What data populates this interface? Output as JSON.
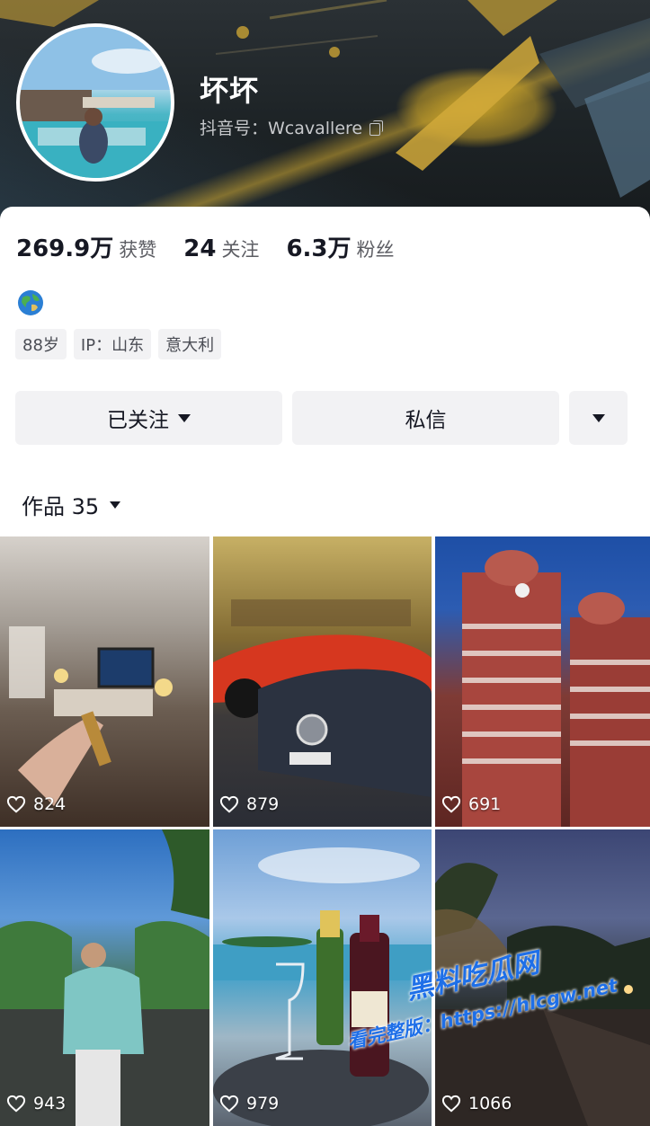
{
  "profile": {
    "nickname": "坏坏",
    "douyin_id": "抖音号：Wcavallere"
  },
  "stats": [
    {
      "value": "269.9万",
      "label": "获赞"
    },
    {
      "value": "24",
      "label": "关注"
    },
    {
      "value": "6.3万",
      "label": "粉丝"
    }
  ],
  "bio_icon": "globe-icon",
  "tags": [
    "88岁",
    "IP：山东",
    "意大利"
  ],
  "actions": {
    "follow_label": "已关注",
    "message_label": "私信"
  },
  "works_tab": {
    "label": "作品 35"
  },
  "videos": [
    {
      "likes": "824"
    },
    {
      "likes": "879"
    },
    {
      "likes": "691"
    },
    {
      "likes": "943"
    },
    {
      "likes": "979"
    },
    {
      "likes": "1066"
    }
  ],
  "watermark": {
    "site": "黑料吃瓜网",
    "url": "看完整版：https://hlcgw.net"
  }
}
